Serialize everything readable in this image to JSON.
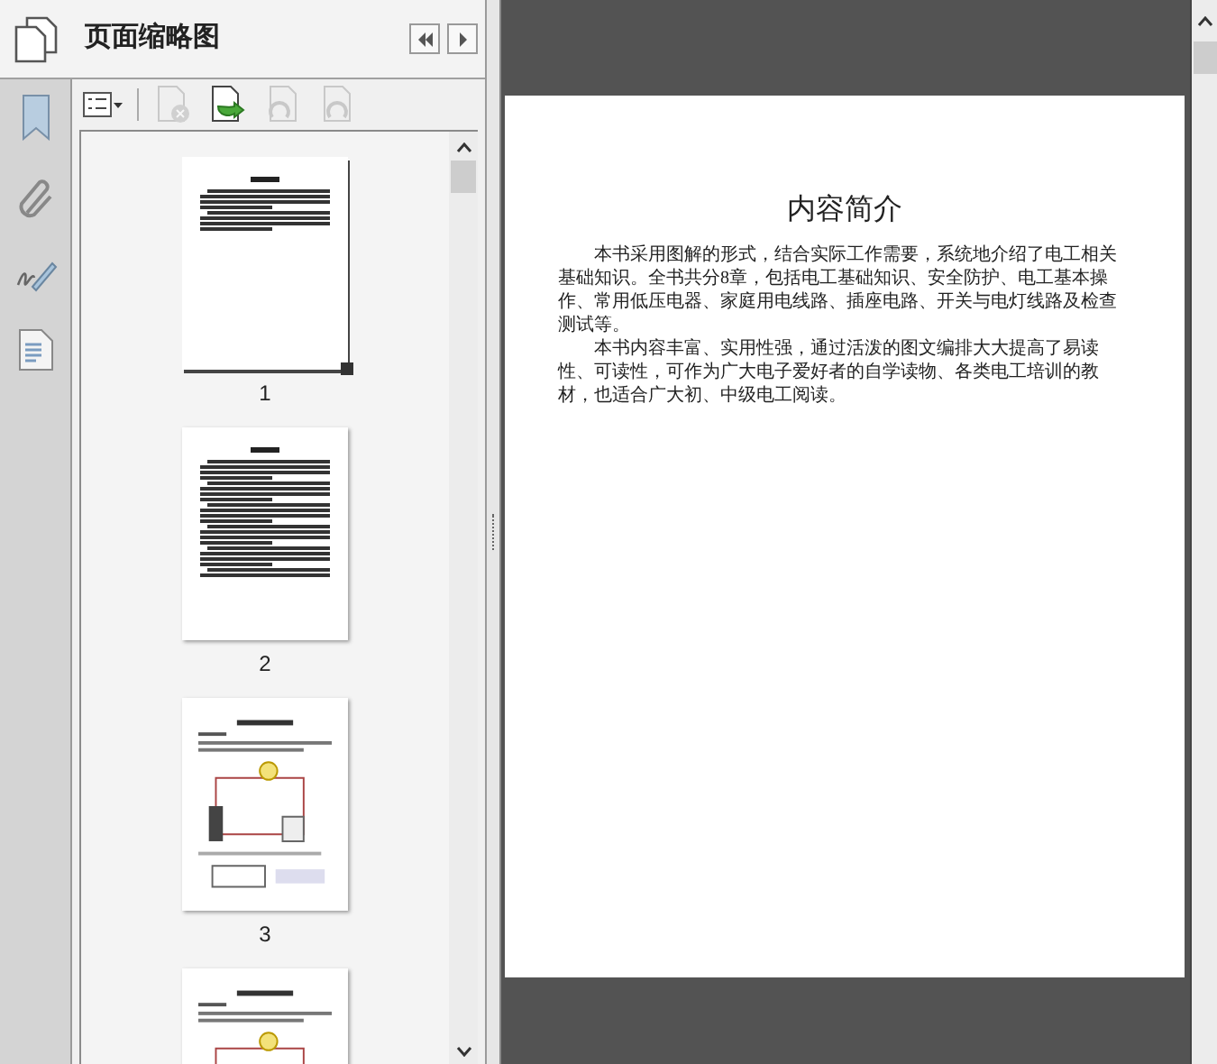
{
  "panel": {
    "title": "页面缩略图"
  },
  "thumbnails": [
    {
      "label": "1",
      "selected": true,
      "kind": "text"
    },
    {
      "label": "2",
      "selected": false,
      "kind": "text"
    },
    {
      "label": "3",
      "selected": false,
      "kind": "illustrated"
    },
    {
      "selected": false,
      "kind": "illustrated"
    }
  ],
  "document_page": {
    "title": "内容简介",
    "paragraphs": [
      "本书采用图解的形式，结合实际工作需要，系统地介绍了电工相关基础知识。全书共分8章，包括电工基础知识、安全防护、电工基本操作、常用低压电器、家庭用电线路、插座电路、开关与电灯线路及检查测试等。",
      "本书内容丰富、实用性强，通过活泼的图文编排大大提高了易读性、可读性，可作为广大电子爱好者的自学读物、各类电工培训的教材，也适合广大初、中级电工阅读。"
    ]
  }
}
